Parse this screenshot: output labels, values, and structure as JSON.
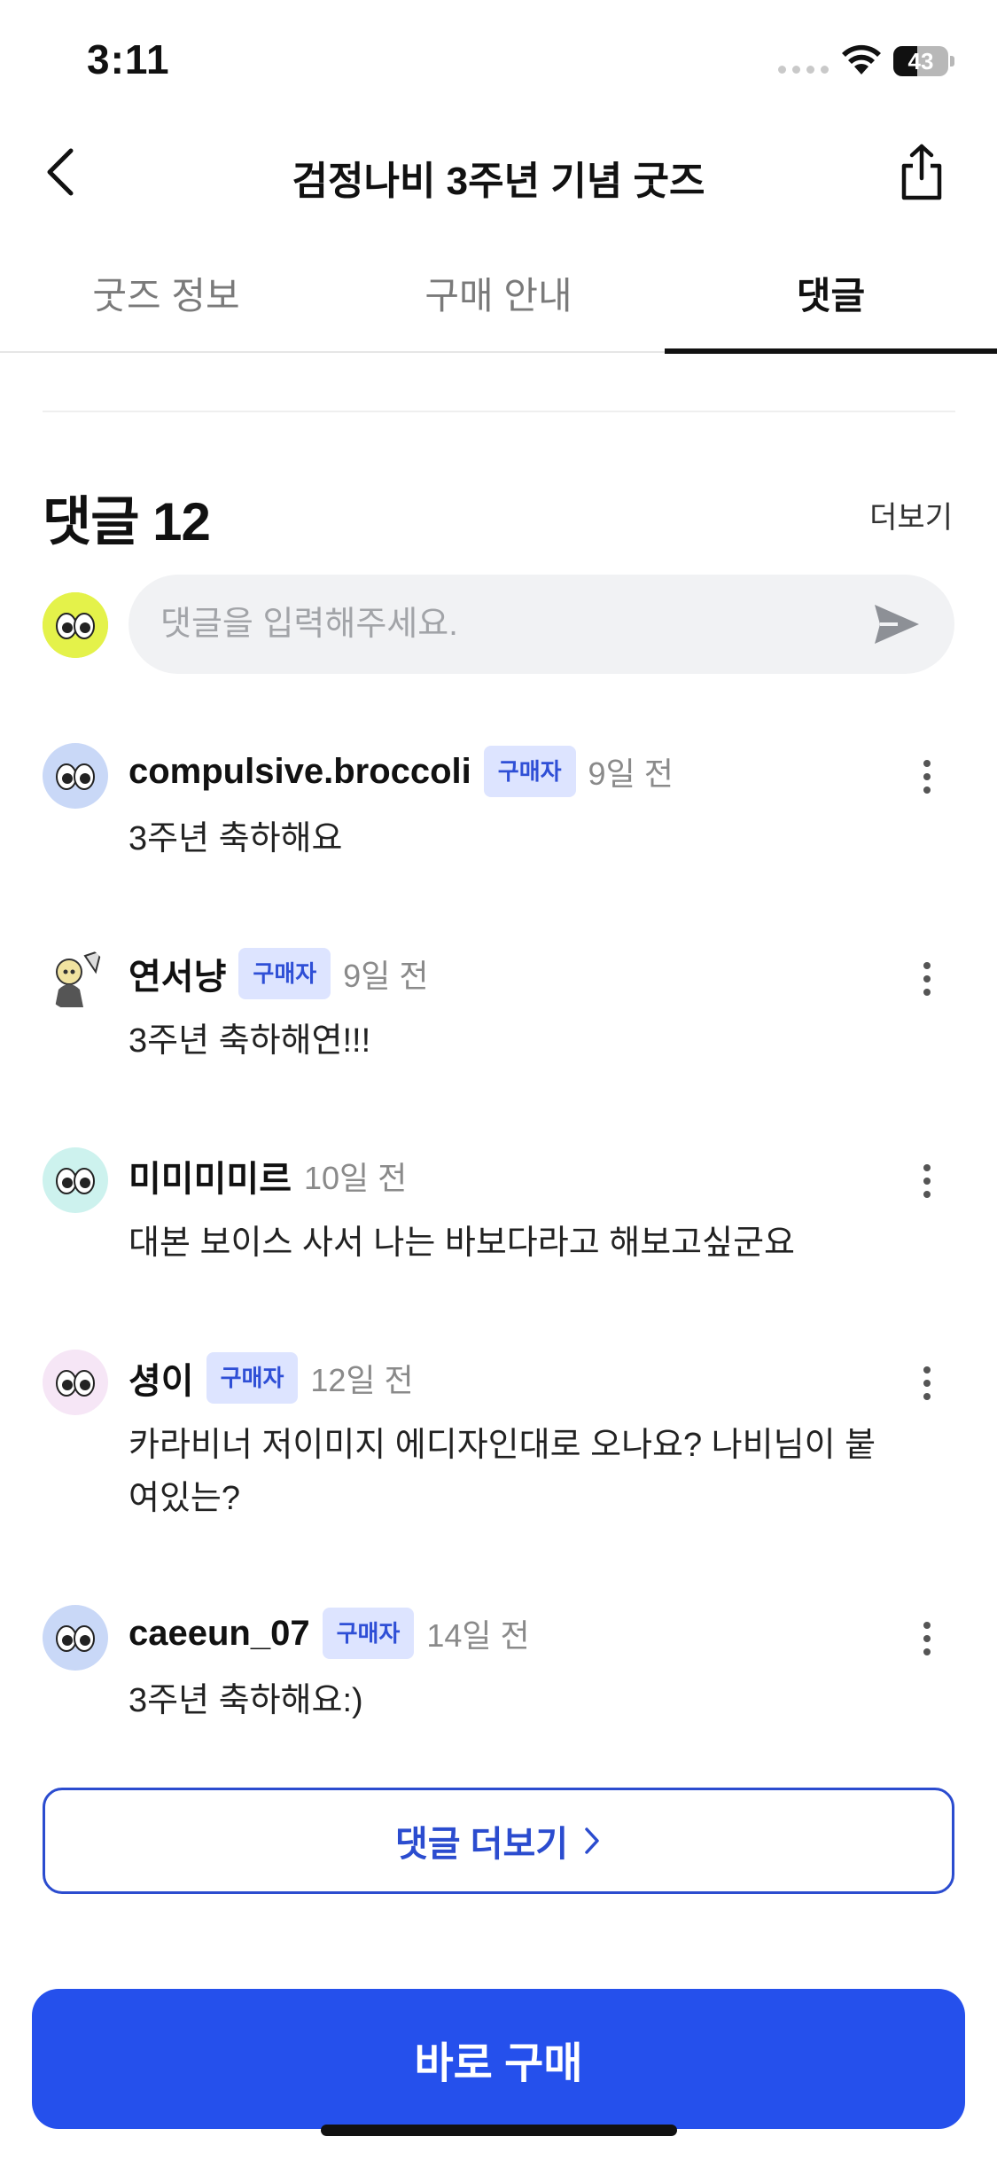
{
  "status_bar": {
    "time": "3:11",
    "battery": "43",
    "battery_level_percent": 43
  },
  "header": {
    "title": "검정나비 3주년 기념 굿즈",
    "back_icon": "chevron-left-icon",
    "share_icon": "share-icon"
  },
  "tabs": [
    {
      "label": "굿즈 정보",
      "active": false
    },
    {
      "label": "구매 안내",
      "active": false
    },
    {
      "label": "댓글",
      "active": true
    }
  ],
  "comments_section": {
    "title": "댓글 12",
    "more_label": "더보기",
    "input_placeholder": "댓글을 입력해주세요.",
    "send_icon": "send-icon"
  },
  "comments": [
    {
      "username": "compulsive.broccoli",
      "badge": "구매자",
      "time": "9일 전",
      "text": "3주년 축하해요",
      "avatar": "eyes-avatar-blue"
    },
    {
      "username": "연서냥",
      "badge": "구매자",
      "time": "9일 전",
      "text": "3주년 축하해연!!!",
      "avatar": "character-avatar"
    },
    {
      "username": "미미미미르",
      "badge": "",
      "time": "10일 전",
      "text": "대본 보이스 사서 나는 바보다라고 해보고싶군요",
      "avatar": "eyes-avatar-mint"
    },
    {
      "username": "셩이",
      "badge": "구매자",
      "time": "12일 전",
      "text": "카라비너 저이미지 에디자인대로 오나요? 나비님이 붙여있는?",
      "avatar": "eyes-avatar-pink"
    },
    {
      "username": "caeeun_07",
      "badge": "구매자",
      "time": "14일 전",
      "text": "3주년 축하해요:)",
      "avatar": "eyes-avatar-blue"
    }
  ],
  "more_comments_button": {
    "label": "댓글 더보기",
    "icon": "chevron-right-icon"
  },
  "buy_button": {
    "label": "바로 구매"
  },
  "colors": {
    "accent": "#2550ec",
    "badge_bg": "#dde4ff",
    "badge_text": "#2f4fd6"
  }
}
